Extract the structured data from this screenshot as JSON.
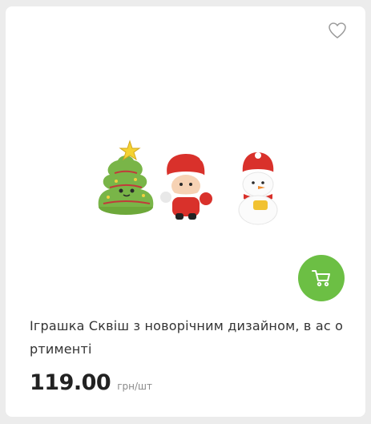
{
  "product": {
    "title": "Іграшка Сквіш з новорічним дизайном, в ас ортименті",
    "price": "119.00",
    "unit": "грн/шт"
  },
  "icons": {
    "favorite": "heart-outline-icon",
    "cart": "shopping-cart-icon"
  },
  "colors": {
    "accent": "#6cbf44",
    "background": "#ececec",
    "card": "#ffffff"
  }
}
